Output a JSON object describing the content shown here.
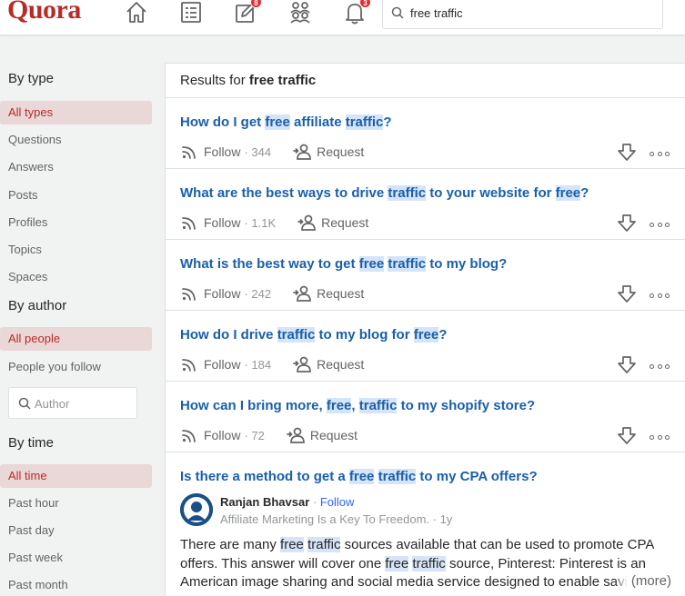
{
  "header": {
    "logo": "Quora",
    "badges": {
      "answer": "8",
      "notifications": "3"
    },
    "search_value": "free traffic"
  },
  "sidebar": {
    "by_type_heading": "By type",
    "types": [
      "All types",
      "Questions",
      "Answers",
      "Posts",
      "Profiles",
      "Topics",
      "Spaces"
    ],
    "by_author_heading": "By author",
    "authors": [
      "All people",
      "People you follow"
    ],
    "author_placeholder": "Author",
    "by_time_heading": "By time",
    "times": [
      "All time",
      "Past hour",
      "Past day",
      "Past week",
      "Past month"
    ]
  },
  "results": {
    "prefix": "Results for",
    "query": "free traffic",
    "follow_label": "Follow",
    "request_label": "Request",
    "questions": [
      {
        "parts": [
          [
            "How do I get ",
            false
          ],
          [
            "free",
            true
          ],
          [
            " affiliate ",
            false
          ],
          [
            "traffic",
            true
          ],
          [
            "?",
            false
          ]
        ],
        "follow_count": "· 344"
      },
      {
        "parts": [
          [
            "What are the best ways to drive ",
            false
          ],
          [
            "traffic",
            true
          ],
          [
            " to your website for ",
            false
          ],
          [
            "free",
            true
          ],
          [
            "?",
            false
          ]
        ],
        "follow_count": "· 1.1K"
      },
      {
        "parts": [
          [
            "What is the best way to get ",
            false
          ],
          [
            "free",
            true
          ],
          [
            " ",
            false
          ],
          [
            "traffic",
            true
          ],
          [
            " to my blog?",
            false
          ]
        ],
        "follow_count": "· 242"
      },
      {
        "parts": [
          [
            "How do I drive ",
            false
          ],
          [
            "traffic",
            true
          ],
          [
            " to my blog for ",
            false
          ],
          [
            "free",
            true
          ],
          [
            "?",
            false
          ]
        ],
        "follow_count": "· 184"
      },
      {
        "parts": [
          [
            "How can I bring more, ",
            false
          ],
          [
            "free",
            true
          ],
          [
            ", ",
            false
          ],
          [
            "traffic",
            true
          ],
          [
            " to my shopify store?",
            false
          ]
        ],
        "follow_count": "· 72"
      }
    ],
    "answer": {
      "title_parts": [
        [
          "Is there a method to get a ",
          false
        ],
        [
          "free",
          true
        ],
        [
          " ",
          false
        ],
        [
          "traffic",
          true
        ],
        [
          " to my CPA offers?",
          false
        ]
      ],
      "author": "Ranjan Bhavsar",
      "separator": " · ",
      "follow": "Follow",
      "credential": "Affiliate Marketing Is a Key To Freedom. · 1y",
      "text_parts": [
        [
          "There are many ",
          false
        ],
        [
          "free",
          true
        ],
        [
          " ",
          false
        ],
        [
          "traffic",
          true
        ],
        [
          " sources available that can be used to promote CPA offers. This answer will cover one ",
          false
        ],
        [
          "free",
          true
        ],
        [
          " ",
          false
        ],
        [
          "traffic",
          true
        ],
        [
          " source, Pinterest: Pinterest is an American image sharing and social media service designed to enable saving",
          false
        ]
      ],
      "more": "(more)"
    }
  },
  "colors": {
    "brand": "#b92b27",
    "link": "#195faa",
    "highlight": "#d5e4f7",
    "active_bg": "#ead7d7"
  }
}
